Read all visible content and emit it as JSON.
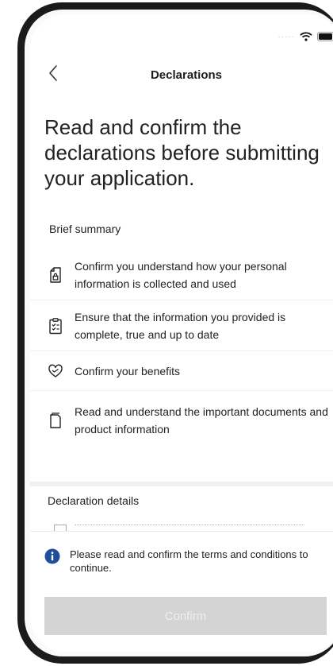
{
  "header": {
    "title": "Declarations"
  },
  "page": {
    "title": "Read and confirm the declarations before submitting your application."
  },
  "summary": {
    "label": "Brief summary",
    "items": [
      {
        "icon": "document-lock-icon",
        "text": "Confirm you understand how your personal information is collected and used"
      },
      {
        "icon": "clipboard-check-icon",
        "text": "Ensure that the information you provided is complete, true and up to date"
      },
      {
        "icon": "heart-icon",
        "text": "Confirm your benefits"
      },
      {
        "icon": "document-icon",
        "text": "Read and understand the important documents and product information"
      }
    ]
  },
  "details": {
    "label": "Declaration details"
  },
  "notice": {
    "icon": "info-icon",
    "text": "Please read and confirm the terms and conditions to continue.",
    "color": "#1f4f9a"
  },
  "actions": {
    "confirm_label": "Confirm",
    "confirm_disabled_color": "#d4d4d4"
  },
  "status_bar": {
    "icons": [
      "signal-dots-icon",
      "wifi-icon",
      "battery-icon"
    ]
  }
}
